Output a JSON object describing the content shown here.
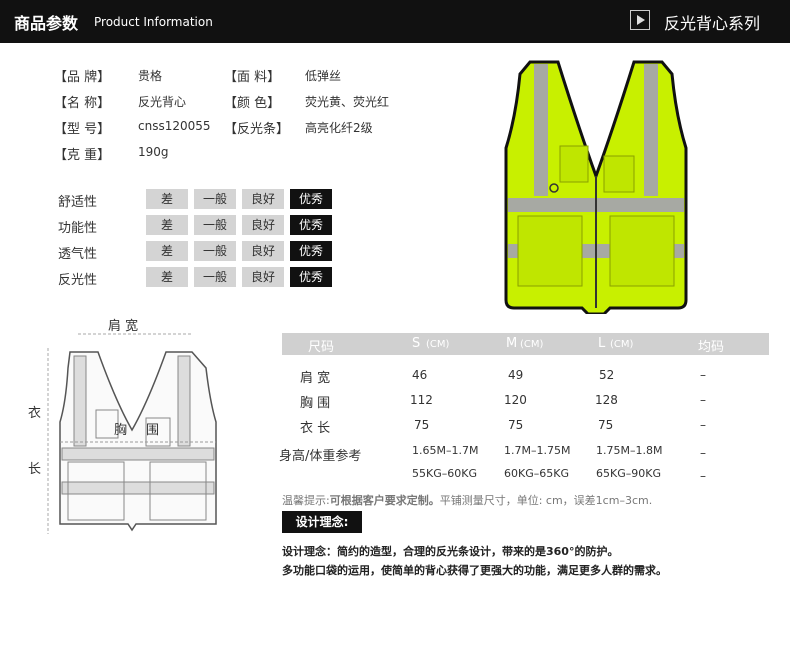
{
  "header": {
    "title_cn": "商品参数",
    "title_en": "Product Information",
    "series": "反光背心系列"
  },
  "params": [
    {
      "label": "【品    牌】",
      "value": "贵格"
    },
    {
      "label": "【名    称】",
      "value": "反光背心"
    },
    {
      "label": "【型    号】",
      "value": "cnss120055"
    },
    {
      "label": "【克    重】",
      "value": "190g"
    },
    {
      "label": "【面    料】",
      "value": "低弹丝"
    },
    {
      "label": "【颜    色】",
      "value": "荧光黄、荧光红"
    },
    {
      "label": "【反光条】",
      "value": "高亮化纤2级"
    }
  ],
  "ratings": {
    "levels": [
      "差",
      "一般",
      "良好",
      "优秀"
    ],
    "items": [
      {
        "name": "舒适性",
        "selected": 3
      },
      {
        "name": "功能性",
        "selected": 3
      },
      {
        "name": "透气性",
        "selected": 3
      },
      {
        "name": "反光性",
        "selected": 3
      }
    ]
  },
  "sketch": {
    "shoulder": "肩  宽",
    "chest_left": "胸",
    "chest_right": "围",
    "length_top": "衣",
    "length_bottom": "长"
  },
  "size_table": {
    "headers": [
      "尺码",
      "S",
      "(CM)",
      "M",
      "(CM)",
      "L",
      "(CM)",
      "均码"
    ],
    "rows": [
      {
        "label": "肩  宽",
        "s": "46",
        "m": "49",
        "l": "52",
        "avg": "–"
      },
      {
        "label": "胸  围",
        "s": "112",
        "m": "120",
        "l": "128",
        "avg": "–"
      },
      {
        "label": "衣  长",
        "s": "75",
        "m": "75",
        "l": "75",
        "avg": "–"
      }
    ],
    "ref_label": "身高/体重参考",
    "height": {
      "s": "1.65M–1.7M",
      "m": "1.7M–1.75M",
      "l": "1.75M–1.8M",
      "avg": "–"
    },
    "weight": {
      "s": "55KG–60KG",
      "m": "60KG–65KG",
      "l": "65KG–90KG",
      "avg": "–"
    }
  },
  "note": {
    "prefix": "温馨提示:",
    "red": "可根据客户要求定制。",
    "rest": "平铺测量尺寸，单位: cm，误差1cm–3cm."
  },
  "design": {
    "title": "设计理念:",
    "line1": "设计理念：简约的造型，合理的反光条设计，带来的是360°的防护。",
    "line2": "多功能口袋的运用，使简单的背心获得了更强大的功能，满足更多人群的需求。"
  },
  "colors": {
    "vest": "#c8f000",
    "stripe": "#a7a9a3",
    "header": "#111111"
  }
}
